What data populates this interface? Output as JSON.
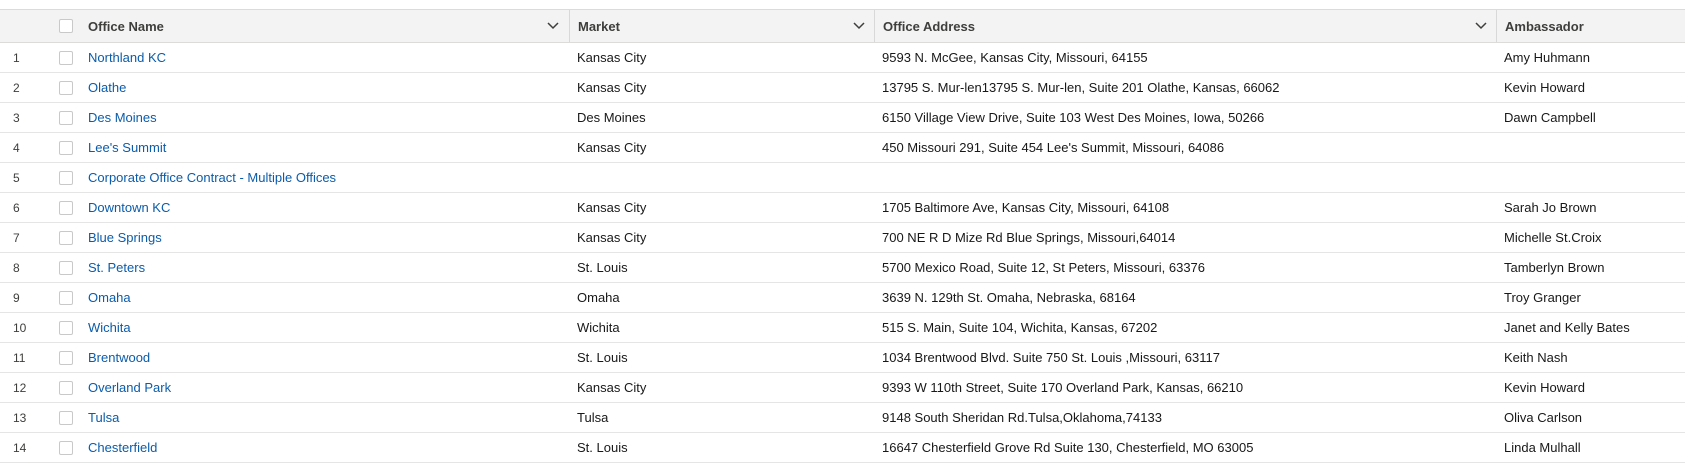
{
  "table": {
    "columns": {
      "name": "Office Name",
      "market": "Market",
      "address": "Office Address",
      "ambassador": "Ambassador"
    },
    "rows": [
      {
        "num": "1",
        "name": "Northland KC",
        "market": "Kansas City",
        "address": "9593 N. McGee, Kansas City, Missouri, 64155",
        "ambassador": "Amy Huhmann"
      },
      {
        "num": "2",
        "name": "Olathe",
        "market": "Kansas City",
        "address": "13795 S. Mur-len13795 S. Mur-len, Suite 201 Olathe, Kansas, 66062",
        "ambassador": "Kevin Howard"
      },
      {
        "num": "3",
        "name": "Des Moines",
        "market": "Des Moines",
        "address": "6150 Village View Drive, Suite 103 West Des Moines, Iowa, 50266",
        "ambassador": "Dawn Campbell"
      },
      {
        "num": "4",
        "name": "Lee's Summit",
        "market": "Kansas City",
        "address": "450 Missouri 291, Suite 454 Lee's Summit, Missouri, 64086",
        "ambassador": ""
      },
      {
        "num": "5",
        "name": "Corporate Office Contract - Multiple Offices",
        "market": "",
        "address": "",
        "ambassador": ""
      },
      {
        "num": "6",
        "name": "Downtown KC",
        "market": "Kansas City",
        "address": "1705 Baltimore Ave, Kansas City, Missouri, 64108",
        "ambassador": "Sarah Jo Brown"
      },
      {
        "num": "7",
        "name": "Blue Springs",
        "market": "Kansas City",
        "address": "700 NE R D Mize Rd Blue Springs, Missouri,64014",
        "ambassador": "Michelle St.Croix"
      },
      {
        "num": "8",
        "name": "St. Peters",
        "market": "St. Louis",
        "address": "5700 Mexico Road, Suite 12, St Peters, Missouri, 63376",
        "ambassador": "Tamberlyn Brown"
      },
      {
        "num": "9",
        "name": "Omaha",
        "market": "Omaha",
        "address": "3639 N. 129th St. Omaha, Nebraska, 68164",
        "ambassador": "Troy Granger"
      },
      {
        "num": "10",
        "name": "Wichita",
        "market": "Wichita",
        "address": "515 S. Main, Suite 104, Wichita, Kansas, 67202",
        "ambassador": "Janet and Kelly Bates"
      },
      {
        "num": "11",
        "name": "Brentwood",
        "market": "St. Louis",
        "address": "1034 Brentwood Blvd. Suite 750 St. Louis ,Missouri, 63117",
        "ambassador": "Keith Nash"
      },
      {
        "num": "12",
        "name": "Overland Park",
        "market": "Kansas City",
        "address": "9393 W 110th Street, Suite 170 Overland Park, Kansas, 66210",
        "ambassador": "Kevin Howard"
      },
      {
        "num": "13",
        "name": "Tulsa",
        "market": "Tulsa",
        "address": "9148 South Sheridan Rd.Tulsa,Oklahoma,74133",
        "ambassador": "Oliva Carlson"
      },
      {
        "num": "14",
        "name": "Chesterfield",
        "market": "St. Louis",
        "address": "16647 Chesterfield Grove Rd Suite 130, Chesterfield, MO 63005",
        "ambassador": "Linda Mulhall"
      }
    ]
  },
  "icons": {
    "header_checkbox": "checkbox-icon",
    "column_menu": "chevron-down-icon"
  },
  "colors": {
    "link": "#0b5cab",
    "header_bg": "#f3f3f3",
    "border": "#dddbda"
  }
}
